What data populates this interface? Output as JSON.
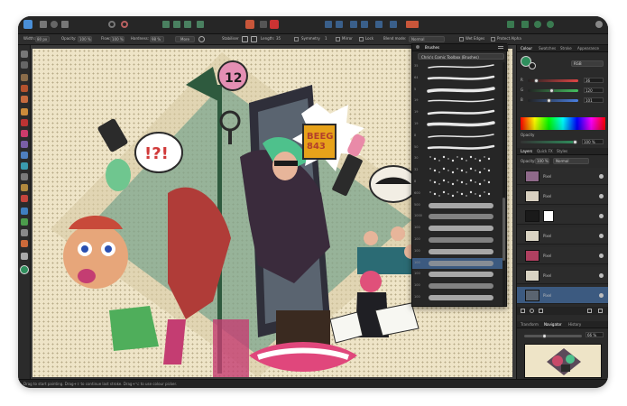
{
  "context_toolbar": {
    "width_label": "Width:",
    "width_value": "80 px",
    "opacity_label": "Opacity:",
    "opacity_value": "100 %",
    "flow_label": "Flow:",
    "flow_value": "100 %",
    "hardness_label": "Hardness:",
    "hardness_value": "98 %",
    "more_label": "More",
    "stabiliser_label": "Stabiliser",
    "length_label": "Length:",
    "length_value": "35",
    "symmetry_label": "Symmetry",
    "symmetry_value": "1",
    "mirror_label": "Mirror",
    "lock_label": "Lock",
    "blend_mode_label": "Blend mode:",
    "blend_mode_value": "Normal",
    "wet_edges_label": "Wet Edges",
    "protect_alpha_label": "Protect Alpha"
  },
  "brushes_panel": {
    "title": "Brushes",
    "category": "Chris's Comic Toolbox (Brushes)",
    "brush_sizes": [
      "35",
      "64",
      "5",
      "19",
      "19",
      "19",
      "8",
      "50",
      "30",
      "32",
      "8",
      "600",
      "500",
      "1000",
      "100",
      "100",
      "100",
      "100",
      "100",
      "100",
      "100"
    ],
    "selected_index": 17
  },
  "colour_panel": {
    "tabs": [
      "Colour",
      "Swatches",
      "Stroke",
      "Appearance"
    ],
    "model": "RGB",
    "rows": [
      {
        "channel": "R",
        "value": "36",
        "color": "#e04545",
        "pos": 0.14
      },
      {
        "channel": "G",
        "value": "120",
        "color": "#45c060",
        "pos": 0.47
      },
      {
        "channel": "B",
        "value": "101",
        "color": "#4a7fe0",
        "pos": 0.4
      }
    ],
    "opacity_label": "Opacity",
    "opacity_value": "100 %"
  },
  "layers_panel": {
    "tabs": [
      "Layers",
      "Quick FX",
      "Styles"
    ],
    "opacity_label": "Opacity:",
    "opacity_value": "100 %",
    "blend_value": "Normal",
    "layer_names": [
      "Pixel",
      "Pixel",
      "",
      "Pixel",
      "Pixel",
      "Pixel",
      "Pixel"
    ],
    "selected_index": 6
  },
  "navigator_panel": {
    "tabs": [
      "Transform",
      "Navigator",
      "History"
    ],
    "zoom_value": "66 %"
  },
  "status_bar": {
    "text": "Drag to start painting. Drag+⇧ to continue last stroke. Drag+⌥ to use colour picker."
  },
  "art": {
    "sign_number": "12",
    "beeg_text": "BEEG\n843",
    "speech_bubble": "!?!"
  },
  "colors": {
    "accent": "#3c5a80",
    "primary_swatch": "#2f8f5d",
    "canvas_bg": "#eee4c7"
  }
}
